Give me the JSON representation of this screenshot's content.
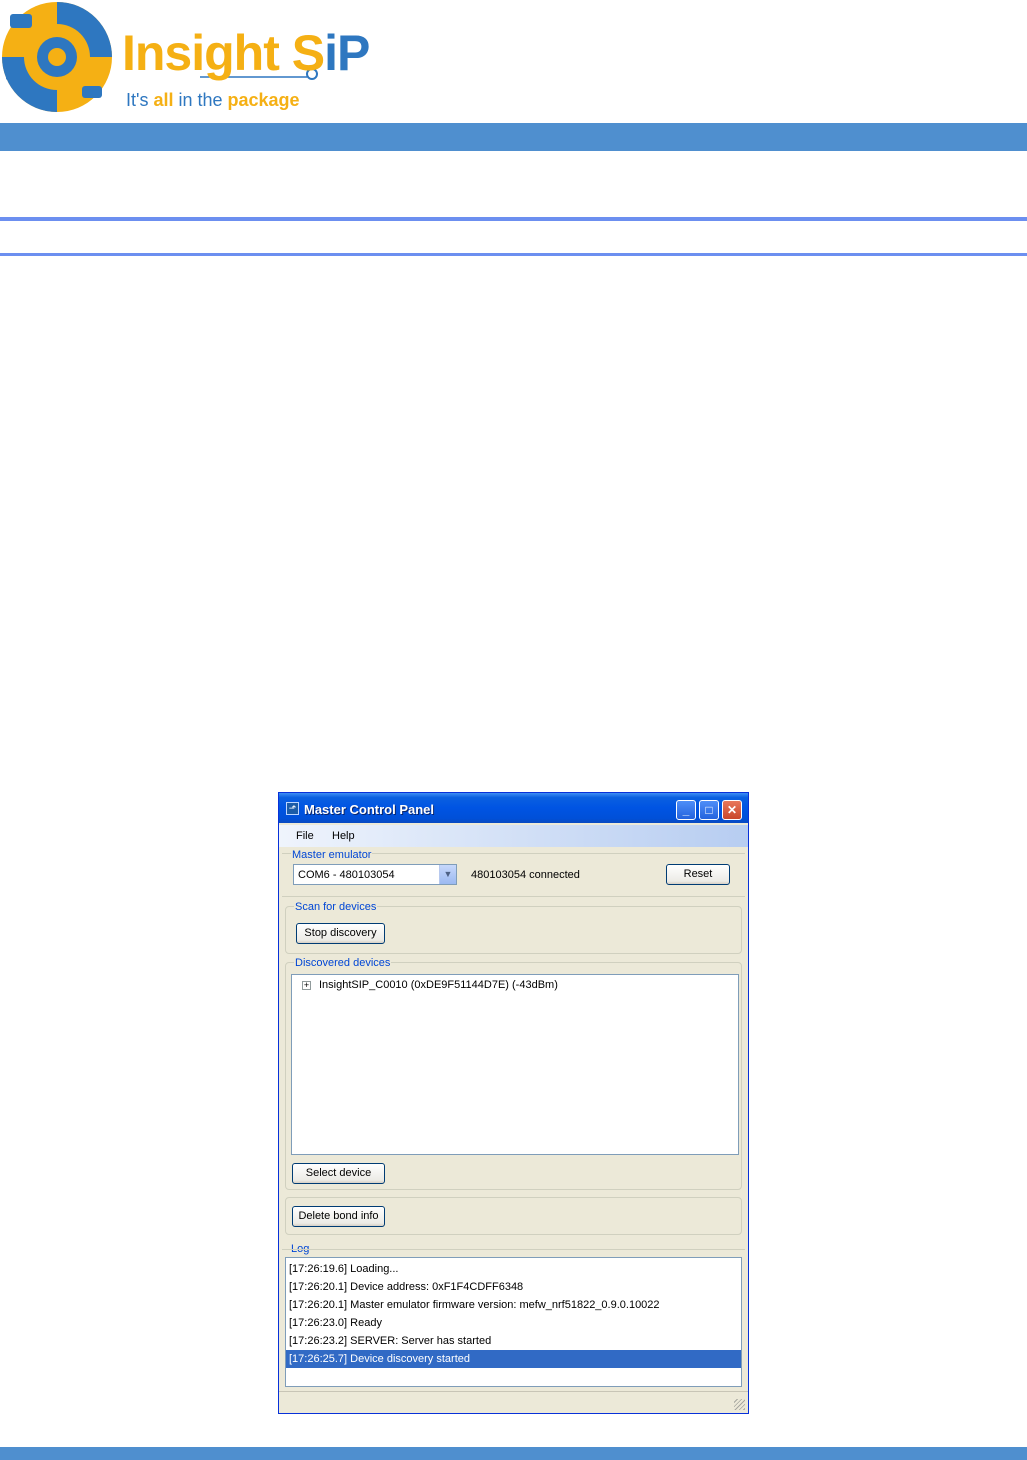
{
  "header": {
    "brand_part1": "Insight S",
    "brand_part2": "iP",
    "tagline_pre": "It's ",
    "tagline_bold1": "all",
    "tagline_mid": " in the ",
    "tagline_bold2": "package"
  },
  "window": {
    "title": "Master Control Panel",
    "menu": [
      "File",
      "Help"
    ],
    "master_emulator": {
      "label": "Master emulator",
      "port_selected": "COM6 - 480103054",
      "status": "480103054 connected",
      "reset_label": "Reset"
    },
    "scan": {
      "label": "Scan for devices",
      "button_label": "Stop discovery"
    },
    "discovered": {
      "label": "Discovered devices",
      "items": [
        "InsightSIP_C0010 (0xDE9F51144D7E) (-43dBm)"
      ],
      "select_label": "Select device"
    },
    "bond": {
      "button_label": "Delete bond info"
    },
    "log": {
      "label": "Log",
      "lines": [
        "[17:26:19.6] Loading...",
        "[17:26:20.1] Device address: 0xF1F4CDFF6348",
        "[17:26:20.1] Master emulator firmware version: mefw_nrf51822_0.9.0.10022",
        "[17:26:23.0] Ready",
        "[17:26:23.2] SERVER: Server has started",
        "[17:26:25.7] Device discovery started"
      ],
      "selected_index": 5
    }
  },
  "colors": {
    "brand_yellow": "#f5b014",
    "brand_blue": "#2e77c0",
    "header_bar": "#4f8fcf",
    "rule": "#6c8ff0",
    "selection": "#316ac5"
  }
}
